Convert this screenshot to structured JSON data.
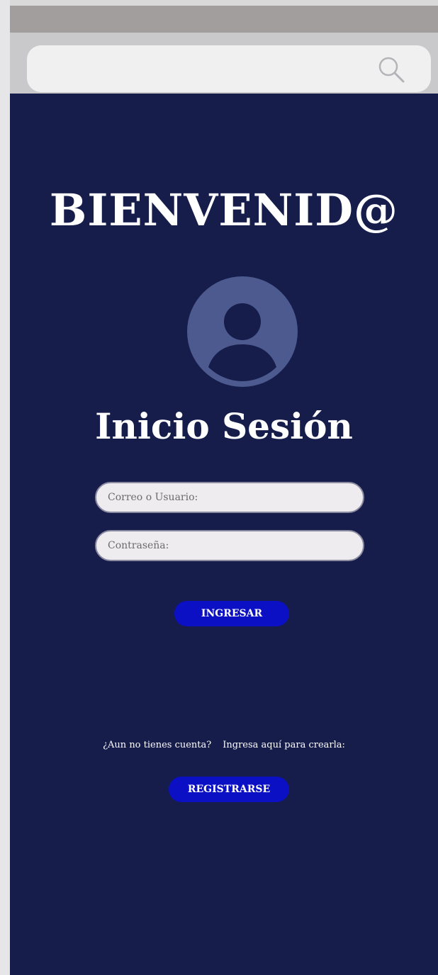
{
  "search": {
    "value": "",
    "placeholder": "",
    "icon": "search-icon"
  },
  "welcome": {
    "heading": "BIENVENID@"
  },
  "avatar": {
    "icon": "user-avatar-icon",
    "bg_color": "#4c5a8f",
    "fg_color": "#161d4b"
  },
  "login": {
    "title": "Inicio Sesión",
    "user_placeholder": "Correo o Usuario:",
    "password_placeholder": "Contraseña:",
    "submit_label": "INGRESAR"
  },
  "register": {
    "prompt": "¿Aun no tienes cuenta?",
    "hint": "Ingresa aquí para crearla:",
    "button_label": "REGISTRARSE"
  },
  "colors": {
    "background": "#161d4b",
    "button": "#0c10c4",
    "title_bar": "#a39e9e",
    "search_area": "#c9c8ca"
  }
}
